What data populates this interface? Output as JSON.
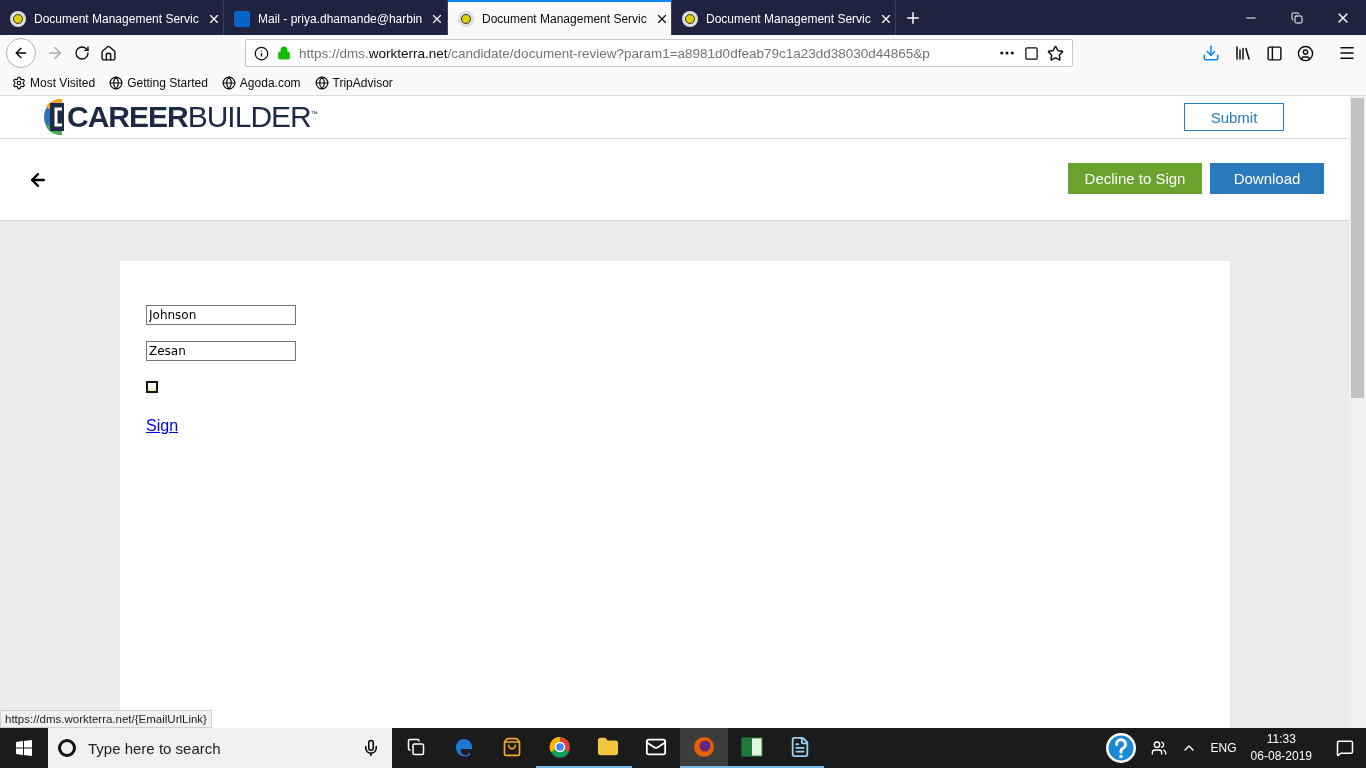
{
  "browser": {
    "tabs": [
      {
        "title": "Document Management Servic",
        "kind": "dms",
        "selected": false
      },
      {
        "title": "Mail - priya.dhamande@harbin",
        "kind": "mail",
        "selected": false
      },
      {
        "title": "Document Management Servic",
        "kind": "dms",
        "selected": true
      },
      {
        "title": "Document Management Servic",
        "kind": "dms",
        "selected": false
      }
    ],
    "address": {
      "prefix": "https://dms.",
      "domain": "workterra.net",
      "path": "/candidate/document-review?param1=a8981d0dfeab79c1a23dd38030d44865&p"
    },
    "bookmarks": [
      {
        "label": "Most Visited",
        "kind": "gear"
      },
      {
        "label": "Getting Started",
        "kind": "globe"
      },
      {
        "label": "Agoda.com",
        "kind": "globe"
      },
      {
        "label": "TripAdvisor",
        "kind": "globe"
      }
    ],
    "status_link": "https://dms.workterra.net/{EmailUrlLink}"
  },
  "page": {
    "logo": "**CAREER**BUILDER$^{™}$",
    "submit": "Submit",
    "actions": [
      {
        "label": "Decline to Sign",
        "kind": "decline"
      },
      {
        "label": "Download",
        "kind": "download"
      }
    ],
    "form": {
      "fields": [
        {
          "value": "Johnson"
        },
        {
          "value": "Zesan"
        }
      ],
      "checkbox": {
        "checked": false
      },
      "link": "Sign"
    }
  },
  "taskbar": {
    "search_placeholder": "Type here to search",
    "apps": [
      {
        "kind": "taskview",
        "running": false,
        "selected": false
      },
      {
        "kind": "edge",
        "running": false,
        "selected": false
      },
      {
        "kind": "store",
        "running": false,
        "selected": false
      },
      {
        "kind": "chrome",
        "running": true,
        "selected": false
      },
      {
        "kind": "explorer",
        "running": true,
        "selected": false
      },
      {
        "kind": "mail",
        "running": false,
        "selected": false
      },
      {
        "kind": "firefox",
        "running": true,
        "selected": true
      },
      {
        "kind": "excel",
        "running": true,
        "selected": false
      },
      {
        "kind": "notepad",
        "running": true,
        "selected": false
      }
    ],
    "language": "ENG",
    "time": "11:33",
    "date": "06-08-2019"
  }
}
